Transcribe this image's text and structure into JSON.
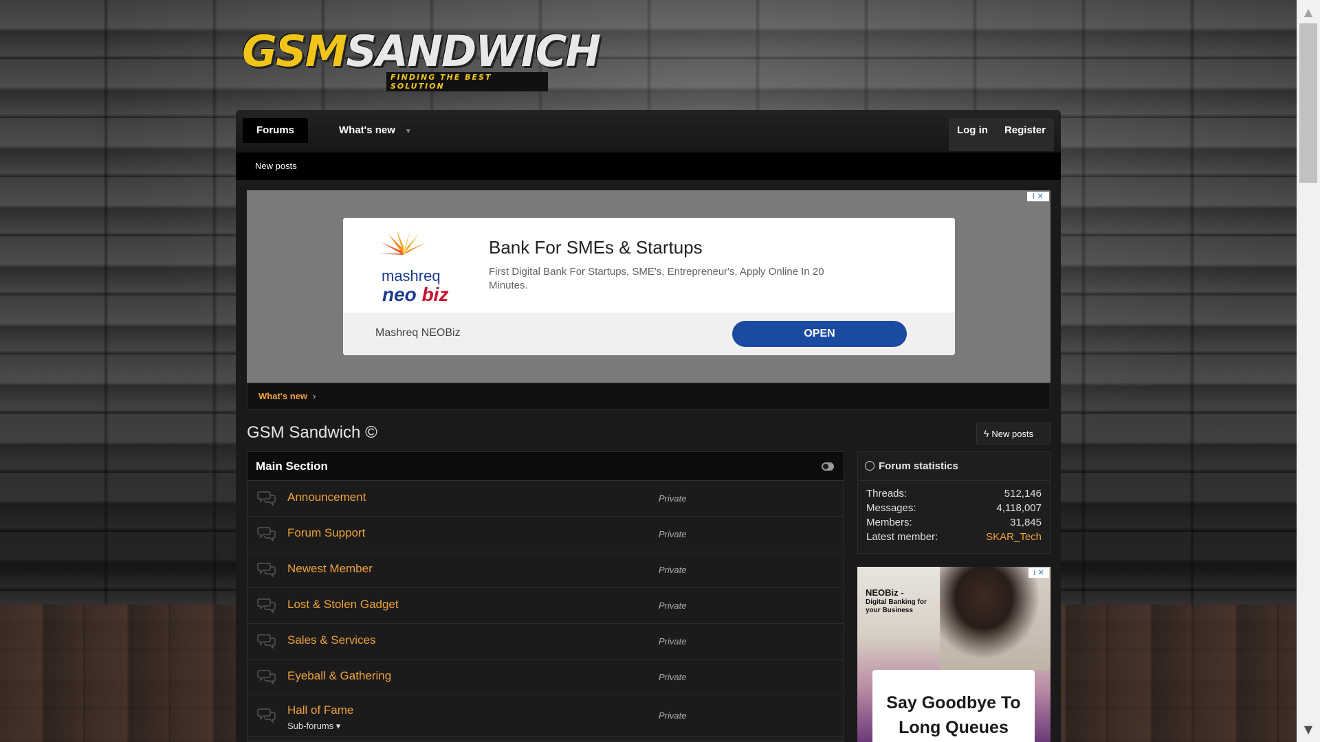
{
  "logo": {
    "part1": "GSM",
    "part2": "SANDWICH",
    "tagline": "FINDING THE BEST SOLUTION"
  },
  "nav": {
    "forums": "Forums",
    "whats_new": "What's new",
    "login": "Log in",
    "register": "Register"
  },
  "subnav": {
    "new_posts": "New posts"
  },
  "ad": {
    "title": "Bank For SMEs & Startups",
    "description": "First Digital Bank For Startups, SME's, Entrepreneur's. Apply Online In 20 Minutes.",
    "brand_line1": "mashreq",
    "brand_neo": "neo",
    "brand_biz": "biz",
    "advertiser": "Mashreq NEOBiz",
    "cta": "OPEN",
    "choices": "i ✕"
  },
  "breadcrumb": {
    "item": "What's new",
    "chevron": "›"
  },
  "page": {
    "title": "GSM Sandwich ©",
    "new_posts_button": "New posts"
  },
  "main_section": {
    "title": "Main Section",
    "nodes": [
      {
        "title": "Announcement",
        "meta": "Private"
      },
      {
        "title": "Forum Support",
        "meta": "Private"
      },
      {
        "title": "Newest Member",
        "meta": "Private"
      },
      {
        "title": "Lost & Stolen Gadget",
        "meta": "Private"
      },
      {
        "title": "Sales & Services",
        "meta": "Private"
      },
      {
        "title": "Eyeball & Gathering",
        "meta": "Private"
      },
      {
        "title": "Hall of Fame",
        "meta": "Private",
        "sub": "Sub-forums ▾"
      }
    ]
  },
  "stats": {
    "title": "Forum statistics",
    "threads_label": "Threads:",
    "threads": "512,146",
    "messages_label": "Messages:",
    "messages": "4,118,007",
    "members_label": "Members:",
    "members": "31,845",
    "latest_label": "Latest member:",
    "latest": "SKAR_Tech"
  },
  "side_ad": {
    "brand": "NEOBiz -",
    "tagline": "Digital Banking for your Business",
    "headline": "Say Goodbye To Long Queues",
    "choices": "i ✕"
  },
  "colors": {
    "accent": "#f0a23a",
    "logo_yellow": "#f0c419",
    "ad_button": "#1a4ba0"
  }
}
